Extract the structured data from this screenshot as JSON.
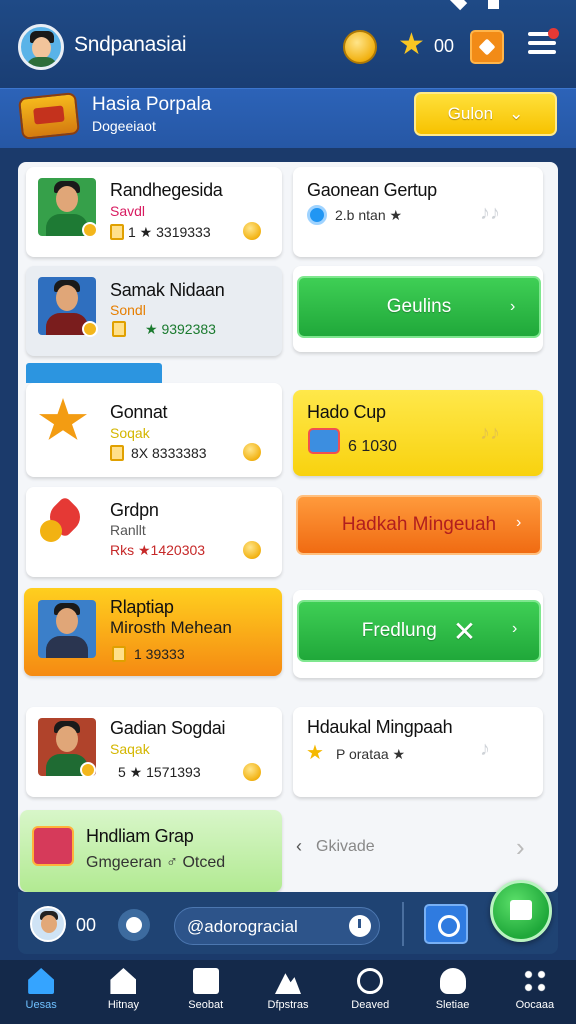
{
  "header": {
    "app_title": "Sndpanasiai",
    "star_count": "00",
    "icons": [
      "avatar",
      "coin-icon",
      "star-icon",
      "gift-icon",
      "menu-icon"
    ]
  },
  "banner": {
    "title": "Hasia Porpala",
    "subtitle": "Dogeeiaot",
    "button_label": "Gulon",
    "button_chevron": "⌄"
  },
  "cards_left": [
    {
      "name": "Randhegesida",
      "sub": "Savdl",
      "stat": "1 ★ 3319333",
      "sub_color": "#d81b60"
    },
    {
      "name": "Samak Nidaan",
      "sub": "Sondl",
      "stat": "★ 9392383",
      "sub_color": "#e67e00"
    },
    {
      "name": "Gonnat",
      "sub": "Soqak",
      "stat": "8X 8333383",
      "sub_color": "#d4b600"
    },
    {
      "name": "Grdpn",
      "sub": "Ranllt",
      "stat": "Rks ★1420303",
      "sub_color": "#555555"
    },
    {
      "name": "Rlaptiap",
      "sub": "Mirosth Mehean",
      "stat": "1 39333",
      "sub_color": "#1b1b1b"
    },
    {
      "name": "Gadian Sogdai",
      "sub": "Saqak",
      "stat": "5 ★ 1571393",
      "sub_color": "#d4b600"
    },
    {
      "name": "Hndliam Grap",
      "sub": "Gmgeeran ♂ Otced",
      "stat": "",
      "sub_color": "#333333"
    }
  ],
  "cards_right": [
    {
      "title": "Gaonean Gertup",
      "stat": "2.b ntan ★"
    },
    {
      "button": "Geulins"
    },
    {
      "title": "Hado Cup",
      "stat": "6 1030"
    },
    {
      "button": "Hadkah Mingeuah"
    },
    {
      "button": "Fredlung"
    },
    {
      "title": "Hdaukal Mingpaah",
      "stat": "P orataa ★"
    },
    {
      "pager": "Gkivade"
    }
  ],
  "chatbar": {
    "count": "00",
    "input_value": "@adorogracial"
  },
  "nav": [
    {
      "label": "Uesas",
      "icon": "home-icon"
    },
    {
      "label": "Hitnay",
      "icon": "house-icon"
    },
    {
      "label": "Seobat",
      "icon": "bag-icon"
    },
    {
      "label": "Dfpstras",
      "icon": "photo-icon"
    },
    {
      "label": "Deaved",
      "icon": "clock-icon"
    },
    {
      "label": "Sletiae",
      "icon": "person-icon"
    },
    {
      "label": "Oocaaa",
      "icon": "more-icon"
    }
  ],
  "colors": {
    "topbar": "#1f4a86",
    "banner": "#2c63b8",
    "accent_yellow": "#f7c200",
    "accent_green": "#20a83a",
    "accent_orange": "#f06b12"
  }
}
